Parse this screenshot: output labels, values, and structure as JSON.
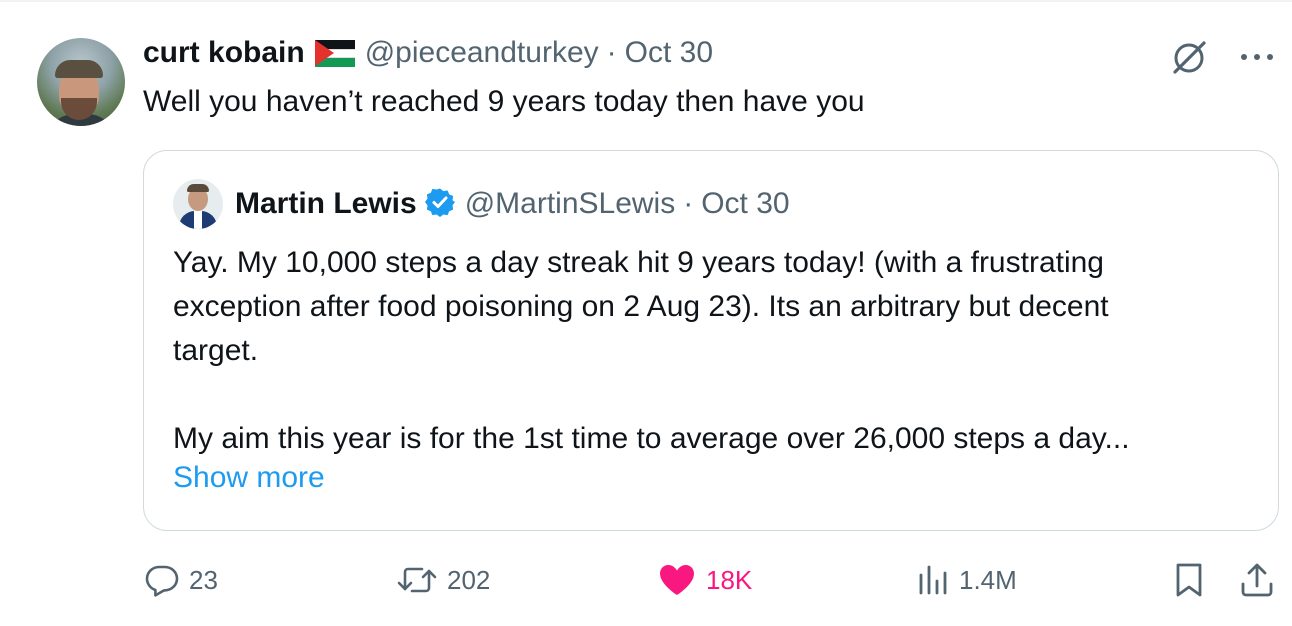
{
  "tweet": {
    "author_name": "curt kobain",
    "author_flag": "flag-palestine",
    "handle": "@pieceandturkey",
    "separator": "·",
    "date": "Oct 30",
    "text": "Well you haven’t reached 9 years today then have you"
  },
  "quoted": {
    "author_name": "Martin Lewis",
    "verified": true,
    "handle": "@MartinSLewis",
    "separator": "·",
    "date": "Oct 30",
    "lines": [
      "Yay. My 10,000 steps a day streak hit 9 years today! (with a frustrating",
      "exception after food poisoning on 2 Aug 23). Its an arbitrary but decent",
      "target."
    ],
    "line_after_gap": "My aim this year is for the 1st time to average over 26,000 steps a day...",
    "show_more": "Show more"
  },
  "actions": {
    "replies": "23",
    "reposts": "202",
    "likes": "18K",
    "views": "1.4M"
  },
  "colors": {
    "accent": "#1d9bf0",
    "like": "#f91880",
    "muted": "#536471",
    "border": "#cfd9de"
  },
  "icons": [
    "grok-icon",
    "more-icon",
    "verified-badge-icon",
    "reply-icon",
    "repost-icon",
    "like-icon",
    "views-icon",
    "bookmark-icon",
    "share-icon"
  ]
}
